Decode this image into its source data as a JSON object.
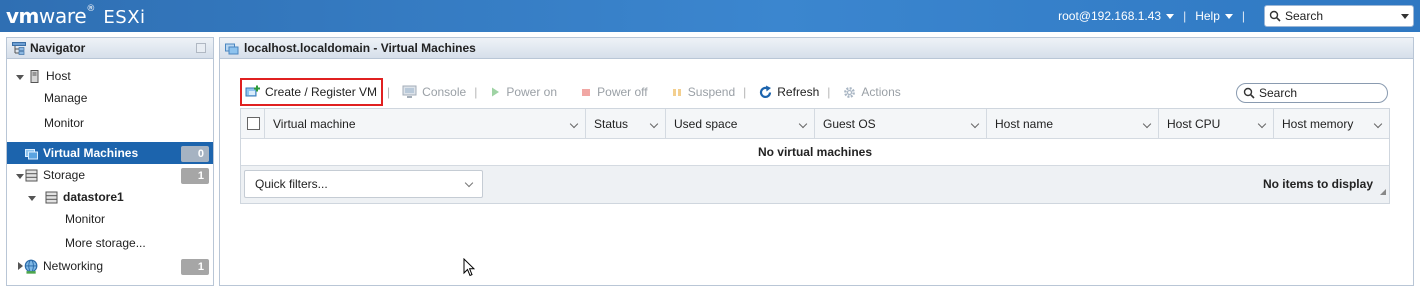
{
  "topbar": {
    "brand_vm": "vm",
    "brand_ware": "ware",
    "brand_reg": "®",
    "product": "ESXi",
    "user": "root@192.168.1.43",
    "help": "Help",
    "search_placeholder": "Search",
    "separator": "|"
  },
  "navigator": {
    "title": "Navigator",
    "host": "Host",
    "manage": "Manage",
    "monitor": "Monitor",
    "virtual_machines": "Virtual Machines",
    "virtual_machines_count": "0",
    "storage": "Storage",
    "storage_count": "1",
    "datastore": "datastore1",
    "datastore_monitor": "Monitor",
    "more_storage": "More storage...",
    "networking": "Networking",
    "networking_count": "1"
  },
  "main": {
    "title": "localhost.localdomain - Virtual Machines",
    "toolbar": {
      "create": "Create / Register VM",
      "console": "Console",
      "power_on": "Power on",
      "power_off": "Power off",
      "suspend": "Suspend",
      "refresh": "Refresh",
      "actions": "Actions",
      "separator": "|"
    },
    "search_placeholder": "Search",
    "columns": [
      "Virtual machine",
      "Status",
      "Used space",
      "Guest OS",
      "Host name",
      "Host CPU",
      "Host memory"
    ],
    "empty_message": "No virtual machines",
    "quick_filters": "Quick filters...",
    "items_status": "No items to display"
  },
  "colors": {
    "topbar": "#3b86cf",
    "selected": "#1c64ad",
    "highlight_border": "#e02020"
  }
}
